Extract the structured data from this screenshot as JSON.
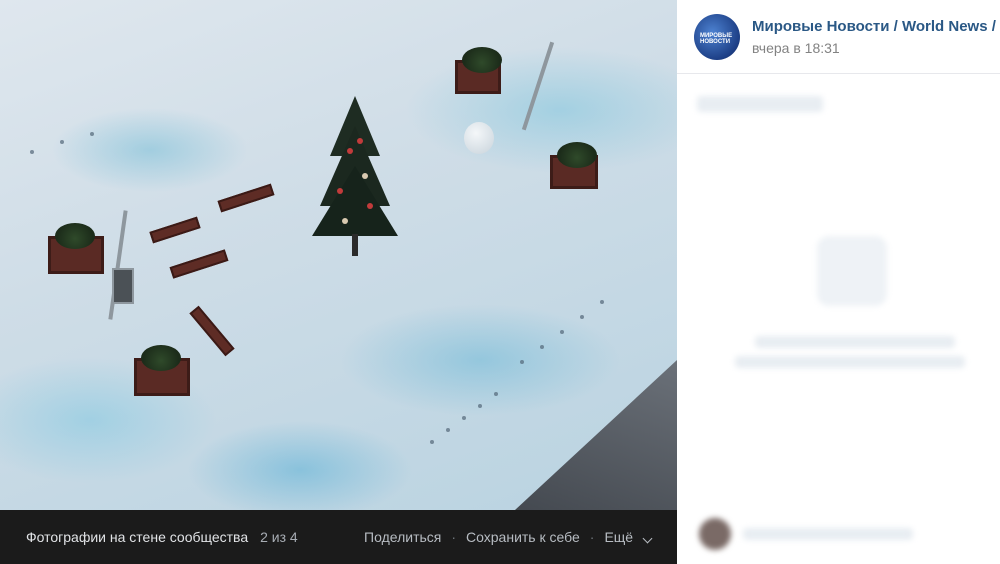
{
  "viewer": {
    "caption": "Фотографии на стене сообщества",
    "counter": "2 из 4",
    "share_label": "Поделиться",
    "save_label": "Сохранить к себе",
    "more_label": "Ещё"
  },
  "post": {
    "group_name": "Мировые Новости / World News / ...",
    "time": "вчера в 18:31",
    "avatar_text": "МИРОВЫЕ НОВОСТИ"
  },
  "colors": {
    "link": "#2a5885",
    "bar_bg": "#1b1b1b"
  },
  "icons": {
    "more": "chevron-down-icon"
  }
}
